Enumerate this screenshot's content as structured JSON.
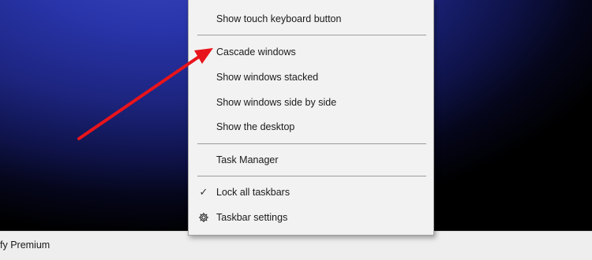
{
  "taskbar": {
    "item_label": "fy Premium"
  },
  "menu": {
    "items": [
      {
        "label": "Show touch keyboard button",
        "icon": ""
      },
      {
        "label": "Cascade windows",
        "icon": ""
      },
      {
        "label": "Show windows stacked",
        "icon": ""
      },
      {
        "label": "Show windows side by side",
        "icon": ""
      },
      {
        "label": "Show the desktop",
        "icon": ""
      },
      {
        "label": "Task Manager",
        "icon": ""
      },
      {
        "label": "Lock all taskbars",
        "icon": "check-icon",
        "checked": true
      },
      {
        "label": "Taskbar settings",
        "icon": "gear-icon"
      }
    ]
  },
  "annotation": {
    "arrow_color": "#e8141b",
    "target": "Cascade windows"
  },
  "colors": {
    "menu_background": "#f2f2f2",
    "taskbar_background": "#eeeeee",
    "desktop_accent": "#2834a8"
  }
}
